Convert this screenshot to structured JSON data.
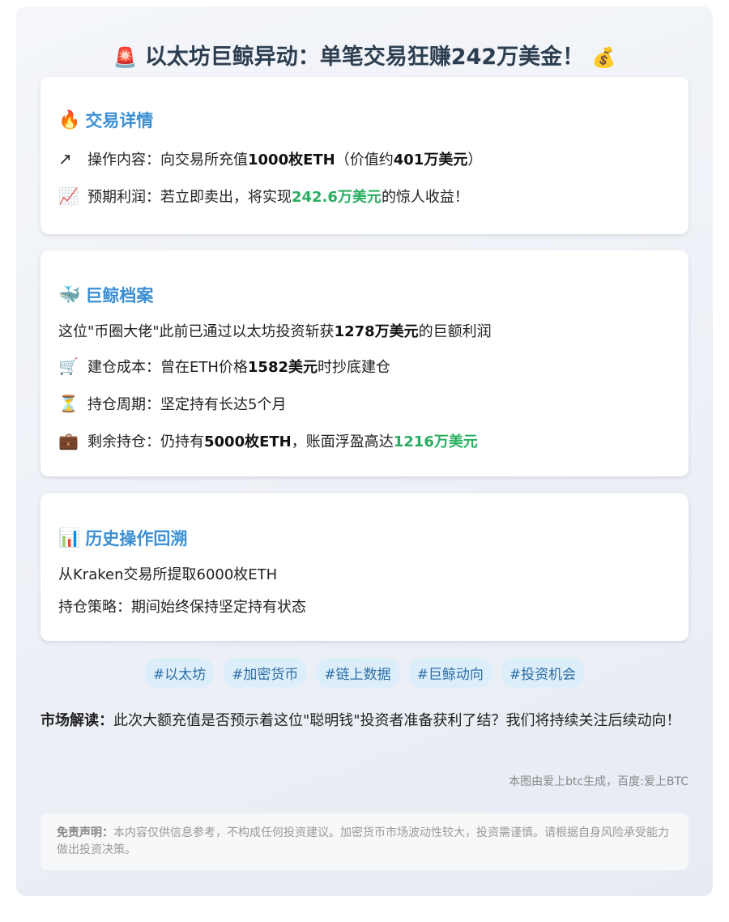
{
  "title": {
    "icon_left": "siren-icon",
    "text": "以太坊巨鲸异动：单笔交易狂赚242万美金！",
    "icon_right": "money-bag-icon"
  },
  "trade": {
    "title": "交易详情",
    "icon": "fire-icon",
    "op": {
      "icon": "arrow-up-right-icon",
      "prefix": "操作内容：向交易所充值",
      "amount": "1000枚ETH",
      "mid": "（价值约",
      "value": "401万美元",
      "suffix": "）"
    },
    "profit": {
      "icon": "chart-increasing-icon",
      "prefix": "预期利润：若立即卖出，将实现",
      "value": "242.6万美元",
      "suffix": "的惊人收益！"
    }
  },
  "whale": {
    "title": "巨鲸档案",
    "icon": "whale-icon",
    "intro": {
      "prefix": "这位\"币圈大佬\"此前已通过以太坊投资斩获",
      "value": "1278万美元",
      "suffix": "的巨额利润"
    },
    "cost": {
      "icon": "cart-icon",
      "prefix": "建仓成本：曾在ETH价格",
      "value": "1582美元",
      "suffix": "时抄底建仓"
    },
    "period": {
      "icon": "hourglass-icon",
      "text": "持仓周期：坚定持有长达5个月"
    },
    "remain": {
      "icon": "briefcase-icon",
      "prefix": "剩余持仓：仍持有",
      "amount": "5000枚ETH",
      "mid": "，账面浮盈高达",
      "value": "1216万美元"
    }
  },
  "history": {
    "title": "历史操作回溯",
    "icon": "bar-chart-icon",
    "line1": "从Kraken交易所提取6000枚ETH",
    "line2": "持仓策略：期间始终保持坚定持有状态"
  },
  "tags": [
    "#以太坊",
    "#加密货币",
    "#链上数据",
    "#巨鲸动向",
    "#投资机会"
  ],
  "interpretation": {
    "label": "市场解读：",
    "text": "此次大额充值是否预示着这位\"聪明钱\"投资者准备获利了结？我们将持续关注后续动向！"
  },
  "credit": "本图由爱上btc生成，百度:爱上BTC",
  "disclaimer": {
    "label": "免责声明：",
    "text": "本内容仅供信息参考，不构成任何投资建议。加密货币市场波动性较大，投资需谨慎。请根据自身风险承受能力做出投资决策。"
  },
  "colors": {
    "accent": "#3b8fd4",
    "green": "#27ae60",
    "title": "#2c3e50"
  }
}
